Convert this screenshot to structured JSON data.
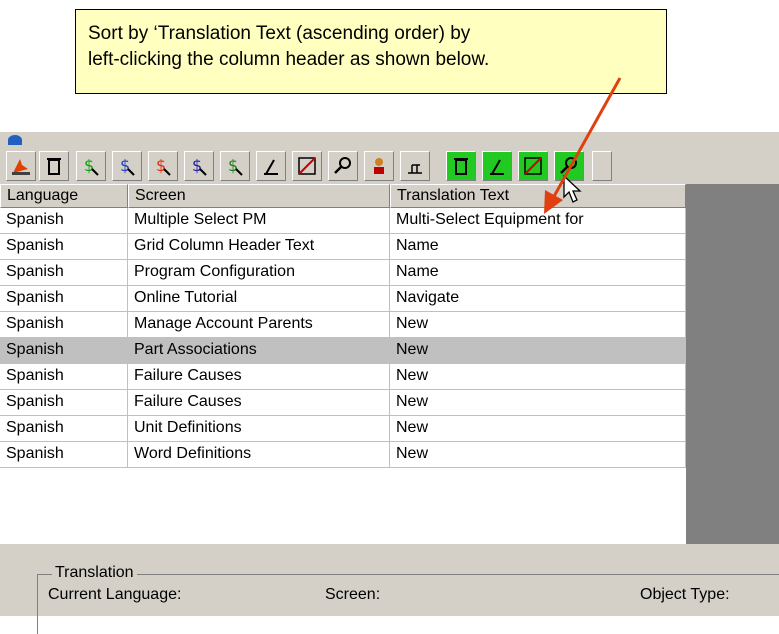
{
  "callout": {
    "line1": "Sort by ‘Translation Text (ascending order) by",
    "line2": "left-clicking the column header as shown below."
  },
  "toolbar": {
    "icons": [
      "flame-icon",
      "trash-icon",
      "dollar-green-icon",
      "dollar-blue-icon",
      "dollar-red-icon",
      "dollar-blue2-icon",
      "dollar-check-icon",
      "angle-icon",
      "area-icon",
      "key-search-icon",
      "person-icon",
      "grid-icon",
      "trash-green-icon",
      "angle-green-icon",
      "area-green-icon",
      "key-green-icon"
    ]
  },
  "grid": {
    "columns": [
      "Language",
      "Screen",
      "Translation Text"
    ],
    "rows": [
      {
        "language": "Spanish",
        "screen": "Multiple Select PM",
        "text": "Multi-Select Equipment for"
      },
      {
        "language": "Spanish",
        "screen": "Grid Column Header Text",
        "text": "Name"
      },
      {
        "language": "Spanish",
        "screen": "Program Configuration",
        "text": "Name"
      },
      {
        "language": "Spanish",
        "screen": "Online Tutorial",
        "text": "Navigate"
      },
      {
        "language": "Spanish",
        "screen": "Manage Account Parents",
        "text": "New"
      },
      {
        "language": "Spanish",
        "screen": "Part Associations",
        "text": "New"
      },
      {
        "language": "Spanish",
        "screen": "Failure Causes",
        "text": "New"
      },
      {
        "language": "Spanish",
        "screen": "Failure Causes",
        "text": "New"
      },
      {
        "language": "Spanish",
        "screen": "Unit Definitions",
        "text": "New"
      },
      {
        "language": "Spanish",
        "screen": "Word Definitions",
        "text": "New"
      }
    ],
    "selected_row": 5
  },
  "panel": {
    "group_title": "Translation",
    "current_language_label": "Current Language:",
    "screen_label": "Screen:",
    "object_type_label": "Object Type:"
  },
  "colors": {
    "callout_bg": "#ffffc0",
    "arrow": "#e04010",
    "green_button": "#22c922",
    "selected_row": "#c0c0c0"
  }
}
